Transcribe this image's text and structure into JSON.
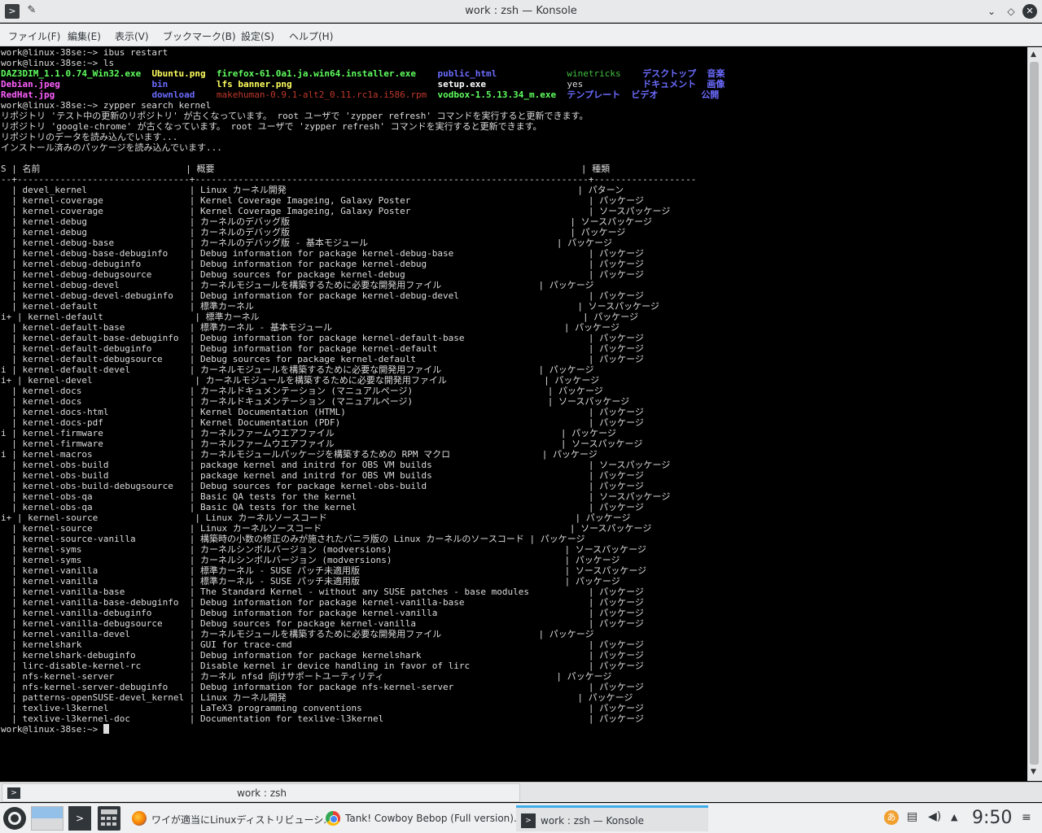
{
  "window": {
    "title": "work : zsh — Konsole",
    "app_icon": "terminal-icon",
    "pin_icon": "pin-icon"
  },
  "menu": [
    "ファイル(F)",
    "編集(E)",
    "表示(V)",
    "ブックマーク(B)",
    "設定(S)",
    "ヘルプ(H)"
  ],
  "terminal": {
    "prompt": "work@linux-38se:~> ",
    "cmd1": "ibus restart",
    "cmd2": "ls",
    "cmd3": "zypper search kernel",
    "ls_rows": [
      [
        {
          "text": "DAZ3DIM_1.1.0.74_Win32.exe",
          "cls": "c-grn",
          "pad": 28
        },
        {
          "text": "Ubuntu.png",
          "cls": "c-yel",
          "pad": 12
        },
        {
          "text": "firefox-61.0a1.ja.win64.installer.exe",
          "cls": "c-grn",
          "pad": 41
        },
        {
          "text": "public_html",
          "cls": "c-blu",
          "pad": 24
        },
        {
          "text": "winetricks",
          "cls": "c-dgrn",
          "pad": 14
        },
        {
          "text": "デスクトップ",
          "cls": "c-blu",
          "pad": 14
        },
        {
          "text": "音楽",
          "cls": "c-blu",
          "pad": 0
        }
      ],
      [
        {
          "text": "Debian.jpeg",
          "cls": "c-mag",
          "pad": 28
        },
        {
          "text": "bin",
          "cls": "c-blu",
          "pad": 12
        },
        {
          "text": "lfs banner.png",
          "cls": "c-yel",
          "pad": 41
        },
        {
          "text": "setup.exe",
          "cls": "c-wht",
          "pad": 24
        },
        {
          "text": "yes",
          "cls": "",
          "pad": 14
        },
        {
          "text": "ドキュメント",
          "cls": "c-blu",
          "pad": 14
        },
        {
          "text": "画像",
          "cls": "c-blu",
          "pad": 0
        }
      ],
      [
        {
          "text": "RedHat.jpg",
          "cls": "c-mag",
          "pad": 28
        },
        {
          "text": "download",
          "cls": "c-blu",
          "pad": 12
        },
        {
          "text": "makehuman-0.9.1-alt2_0.11.rc1a.i586.rpm",
          "cls": "c-red",
          "pad": 41
        },
        {
          "text": "vodbox-1.5.13.34_m.exe",
          "cls": "c-grn",
          "pad": 24
        },
        {
          "text": "テンプレート",
          "cls": "c-blu",
          "pad": 14
        },
        {
          "text": "ビデオ",
          "cls": "c-blu",
          "pad": 14
        },
        {
          "text": "公開",
          "cls": "c-blu",
          "pad": 0
        }
      ]
    ],
    "messages": [
      "リポジトリ 'テスト中の更新のリポジトリ' が古くなっています。 root ユーザで 'zypper refresh' コマンドを実行すると更新できます。",
      "リポジトリ 'google-chrome' が古くなっています。 root ユーザで 'zypper refresh' コマンドを実行すると更新できます。",
      "リポジトリのデータを読み込んでいます...",
      "インストール済みのパッケージを読み込んでいます..."
    ],
    "table_header": [
      "S",
      "名前",
      "概要",
      "種類"
    ],
    "rows": [
      [
        "",
        "devel_kernel",
        "Linux カーネル開発",
        "パターン"
      ],
      [
        "",
        "kernel-coverage",
        "Kernel Coverage Imageing, Galaxy Poster",
        "パッケージ"
      ],
      [
        "",
        "kernel-coverage",
        "Kernel Coverage Imageing, Galaxy Poster",
        "ソースパッケージ"
      ],
      [
        "",
        "kernel-debug",
        "カーネルのデバッグ版",
        "ソースパッケージ"
      ],
      [
        "",
        "kernel-debug",
        "カーネルのデバッグ版",
        "パッケージ"
      ],
      [
        "",
        "kernel-debug-base",
        "カーネルのデバッグ版 - 基本モジュール",
        "パッケージ"
      ],
      [
        "",
        "kernel-debug-base-debuginfo",
        "Debug information for package kernel-debug-base",
        "パッケージ"
      ],
      [
        "",
        "kernel-debug-debuginfo",
        "Debug information for package kernel-debug",
        "パッケージ"
      ],
      [
        "",
        "kernel-debug-debugsource",
        "Debug sources for package kernel-debug",
        "パッケージ"
      ],
      [
        "",
        "kernel-debug-devel",
        "カーネルモジュールを構築するために必要な開発用ファイル",
        "パッケージ"
      ],
      [
        "",
        "kernel-debug-devel-debuginfo",
        "Debug information for package kernel-debug-devel",
        "パッケージ"
      ],
      [
        "",
        "kernel-default",
        "標準カーネル",
        "ソースパッケージ"
      ],
      [
        "i+",
        "kernel-default",
        "標準カーネル",
        "パッケージ"
      ],
      [
        "",
        "kernel-default-base",
        "標準カーネル - 基本モジュール",
        "パッケージ"
      ],
      [
        "",
        "kernel-default-base-debuginfo",
        "Debug information for package kernel-default-base",
        "パッケージ"
      ],
      [
        "",
        "kernel-default-debuginfo",
        "Debug information for package kernel-default",
        "パッケージ"
      ],
      [
        "",
        "kernel-default-debugsource",
        "Debug sources for package kernel-default",
        "パッケージ"
      ],
      [
        "i",
        "kernel-default-devel",
        "カーネルモジュールを構築するために必要な開発用ファイル",
        "パッケージ"
      ],
      [
        "i+",
        "kernel-devel",
        "カーネルモジュールを構築するために必要な開発用ファイル",
        "パッケージ"
      ],
      [
        "",
        "kernel-docs",
        "カーネルドキュメンテーション (マニュアルページ)",
        "パッケージ"
      ],
      [
        "",
        "kernel-docs",
        "カーネルドキュメンテーション (マニュアルページ)",
        "ソースパッケージ"
      ],
      [
        "",
        "kernel-docs-html",
        "Kernel Documentation (HTML)",
        "パッケージ"
      ],
      [
        "",
        "kernel-docs-pdf",
        "Kernel Documentation (PDF)",
        "パッケージ"
      ],
      [
        "i",
        "kernel-firmware",
        "カーネルファームウエアファイル",
        "パッケージ"
      ],
      [
        "",
        "kernel-firmware",
        "カーネルファームウエアファイル",
        "ソースパッケージ"
      ],
      [
        "i",
        "kernel-macros",
        "カーネルモジュールパッケージを構築するための RPM マクロ",
        "パッケージ"
      ],
      [
        "",
        "kernel-obs-build",
        "package kernel and initrd for OBS VM builds",
        "ソースパッケージ"
      ],
      [
        "",
        "kernel-obs-build",
        "package kernel and initrd for OBS VM builds",
        "パッケージ"
      ],
      [
        "",
        "kernel-obs-build-debugsource",
        "Debug sources for package kernel-obs-build",
        "パッケージ"
      ],
      [
        "",
        "kernel-obs-qa",
        "Basic QA tests for the kernel",
        "ソースパッケージ"
      ],
      [
        "",
        "kernel-obs-qa",
        "Basic QA tests for the kernel",
        "パッケージ"
      ],
      [
        "i+",
        "kernel-source",
        "Linux カーネルソースコード",
        "パッケージ"
      ],
      [
        "",
        "kernel-source",
        "Linux カーネルソースコード",
        "ソースパッケージ"
      ],
      [
        "",
        "kernel-source-vanilla",
        "構築時の小数の修正のみが施されたバニラ版の Linux カーネルのソースコード",
        "パッケージ"
      ],
      [
        "",
        "kernel-syms",
        "カーネルシンボルバージョン (modversions)",
        "ソースパッケージ"
      ],
      [
        "",
        "kernel-syms",
        "カーネルシンボルバージョン (modversions)",
        "パッケージ"
      ],
      [
        "",
        "kernel-vanilla",
        "標準カーネル - SUSE パッチ未適用版",
        "ソースパッケージ"
      ],
      [
        "",
        "kernel-vanilla",
        "標準カーネル - SUSE パッチ未適用版",
        "パッケージ"
      ],
      [
        "",
        "kernel-vanilla-base",
        "The Standard Kernel - without any SUSE patches - base modules",
        "パッケージ"
      ],
      [
        "",
        "kernel-vanilla-base-debuginfo",
        "Debug information for package kernel-vanilla-base",
        "パッケージ"
      ],
      [
        "",
        "kernel-vanilla-debuginfo",
        "Debug information for package kernel-vanilla",
        "パッケージ"
      ],
      [
        "",
        "kernel-vanilla-debugsource",
        "Debug sources for package kernel-vanilla",
        "パッケージ"
      ],
      [
        "",
        "kernel-vanilla-devel",
        "カーネルモジュールを構築するために必要な開発用ファイル",
        "パッケージ"
      ],
      [
        "",
        "kernelshark",
        "GUI for trace-cmd",
        "パッケージ"
      ],
      [
        "",
        "kernelshark-debuginfo",
        "Debug information for package kernelshark",
        "パッケージ"
      ],
      [
        "",
        "lirc-disable-kernel-rc",
        "Disable kernel ir device handling in favor of lirc",
        "パッケージ"
      ],
      [
        "",
        "nfs-kernel-server",
        "カーネル nfsd 向けサポートユーティリティ",
        "パッケージ"
      ],
      [
        "",
        "nfs-kernel-server-debuginfo",
        "Debug information for package nfs-kernel-server",
        "パッケージ"
      ],
      [
        "",
        "patterns-openSUSE-devel_kernel",
        "Linux カーネル開発",
        "パッケージ"
      ],
      [
        "",
        "texlive-l3kernel",
        "LaTeX3 programming conventions",
        "パッケージ"
      ],
      [
        "",
        "texlive-l3kernel-doc",
        "Documentation for texlive-l3kernel",
        "パッケージ"
      ]
    ]
  },
  "tab": {
    "label": "work : zsh"
  },
  "taskbar": {
    "tasks": [
      {
        "label": "ワイが適当にLinuxディストリビューシ...",
        "icon": "firefox-icon"
      },
      {
        "label": "Tank! Cowboy Bebop (Full version)...",
        "icon": "chrome-icon"
      },
      {
        "label": "work : zsh — Konsole",
        "icon": "konsole-icon"
      }
    ],
    "clock": "9:50",
    "tray_icons": [
      "input-method-icon",
      "clipboard-icon",
      "volume-icon",
      "tray-expand-icon",
      "menu-icon"
    ]
  }
}
